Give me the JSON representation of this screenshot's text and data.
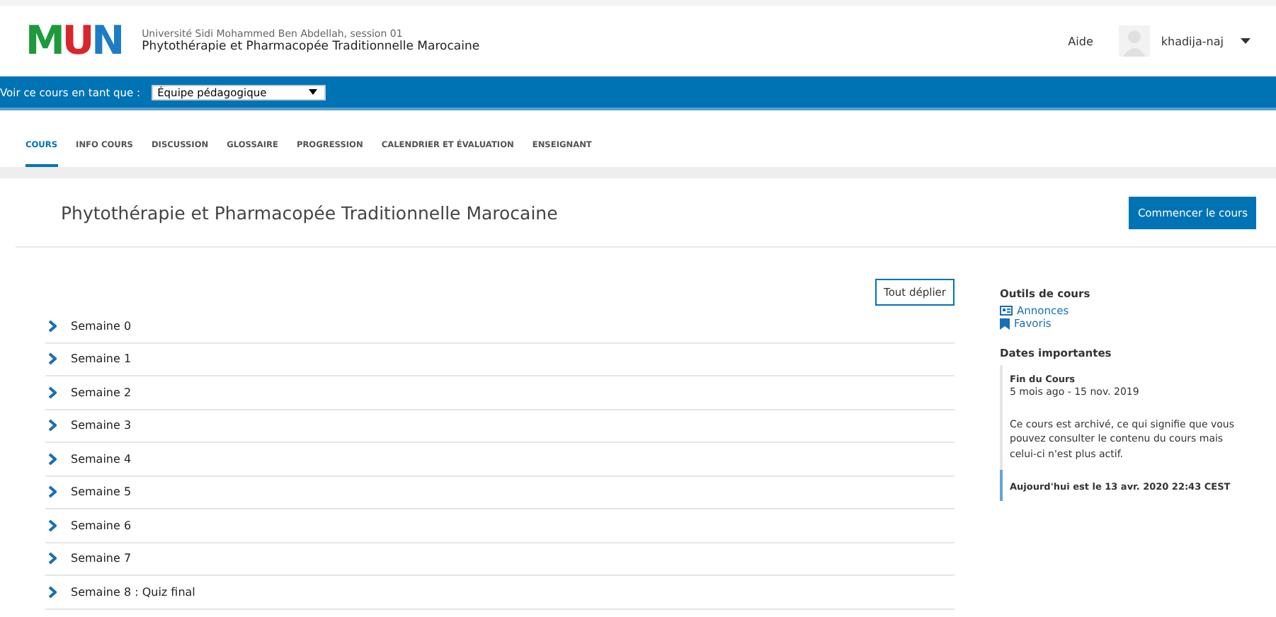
{
  "header": {
    "logo": [
      {
        "letter": "M",
        "color": "#1e9a3c"
      },
      {
        "letter": "U",
        "color": "#d8262c"
      },
      {
        "letter": "N",
        "color": "#1e7cc4"
      }
    ],
    "institution": "Université Sidi Mohammed Ben Abdellah, session 01",
    "course_name": "Phytothérapie et Pharmacopée Traditionnelle Marocaine",
    "help": "Aide",
    "user": "khadija-naj"
  },
  "view_bar": {
    "label": "Voir ce cours en tant que :",
    "select_value": "Équipe pédagogique"
  },
  "tabs": [
    {
      "label": "COURS",
      "selected": true
    },
    {
      "label": "INFO COURS",
      "selected": false
    },
    {
      "label": "DISCUSSION",
      "selected": false
    },
    {
      "label": "GLOSSAIRE",
      "selected": false
    },
    {
      "label": "PROGRESSION",
      "selected": false
    },
    {
      "label": "CALENDRIER ET ÉVALUATION",
      "selected": false
    },
    {
      "label": "ENSEIGNANT",
      "selected": false
    }
  ],
  "course_title": "Phytothérapie et Pharmacopée Traditionnelle Marocaine",
  "start_button": "Commencer le cours",
  "expand_button": "Tout déplier",
  "sections": [
    "Semaine 0",
    "Semaine 1",
    "Semaine 2",
    "Semaine 3",
    "Semaine 4",
    "Semaine 5",
    "Semaine 6",
    "Semaine 7",
    "Semaine 8 : Quiz final"
  ],
  "sidebar": {
    "tools_title": "Outils de cours",
    "tools": [
      {
        "label": "Annonces",
        "kind": "news"
      },
      {
        "label": "Favoris",
        "kind": "bookmark"
      }
    ],
    "dates_title": "Dates importantes",
    "end_title": "Fin du Cours",
    "end_date": "5 mois ago - 15 nov. 2019",
    "archive_note": "Ce cours est archivé, ce qui signifie que vous pouvez consulter le contenu du cours mais celui-ci n'est plus actif.",
    "today": "Aujourd'hui est le 13 avr. 2020 22:43 CEST"
  }
}
